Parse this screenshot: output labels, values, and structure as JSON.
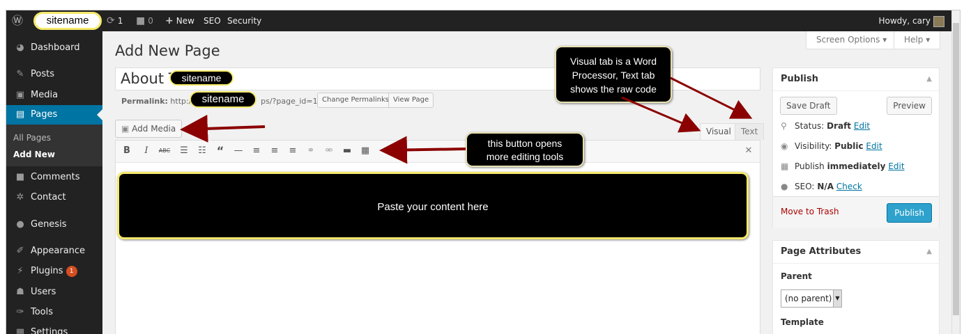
{
  "adminbar": {
    "site_name": "sitename",
    "updates_count": "1",
    "comments_count": "0",
    "new_label": "New",
    "seo_label": "SEO",
    "security_label": "Security",
    "howdy": "Howdy, cary"
  },
  "sidebar": {
    "items": [
      {
        "label": "Dashboard",
        "icon": "dashboard-icon"
      },
      {
        "label": "Posts",
        "icon": "pin-icon"
      },
      {
        "label": "Media",
        "icon": "media-icon"
      },
      {
        "label": "Pages",
        "icon": "pages-icon"
      },
      {
        "label": "Comments",
        "icon": "comment-icon"
      },
      {
        "label": "Contact",
        "icon": "gear-icon"
      },
      {
        "label": "Genesis",
        "icon": "genesis-icon"
      },
      {
        "label": "Appearance",
        "icon": "brush-icon"
      },
      {
        "label": "Plugins",
        "icon": "plug-icon"
      },
      {
        "label": "Users",
        "icon": "users-icon"
      },
      {
        "label": "Tools",
        "icon": "wrench-icon"
      },
      {
        "label": "Settings",
        "icon": "settings-icon"
      }
    ],
    "plugins_badge": "1",
    "submenu": [
      "All Pages",
      "Add New"
    ]
  },
  "screen_options": "Screen Options",
  "help": "Help",
  "page_title": "Add New Page",
  "post_title": {
    "before": "About T",
    "after": "s"
  },
  "permalink": {
    "label": "Permalink:",
    "before": "http://",
    "after": "ps/?page_id=10",
    "change": "Change Permalinks",
    "view": "View Page"
  },
  "add_media": "Add Media",
  "editor_tabs": {
    "visual": "Visual",
    "text": "Text"
  },
  "publish": {
    "title": "Publish",
    "save_draft": "Save Draft",
    "preview": "Preview",
    "status_label": "Status:",
    "status_value": "Draft",
    "visibility_label": "Visibility:",
    "visibility_value": "Public",
    "publish_label": "Publish",
    "publish_value": "immediately",
    "seo_label": "SEO:",
    "seo_value": "N/A",
    "seo_check": "Check",
    "edit": "Edit",
    "trash": "Move to Trash",
    "publish_button": "Publish"
  },
  "page_attributes": {
    "title": "Page Attributes",
    "parent_label": "Parent",
    "parent_value": "(no parent)",
    "template_label": "Template"
  },
  "annotations": {
    "sitename_1": "sitename",
    "sitename_2": "sitename",
    "sitename_3": "sitename",
    "tabs_callout_1": "Visual tab is a Word",
    "tabs_callout_2": "Processor, Text tab",
    "tabs_callout_3": "shows the raw code",
    "button_callout_1": "this button opens",
    "button_callout_2": "more editing tools",
    "content_callout": "Paste your content here"
  },
  "colors": {
    "admin_bar": "#222222",
    "accent": "#0074a2",
    "publish": "#2ea2cc",
    "annotation_arrow": "#8b0000",
    "highlight": "#f5e96a"
  }
}
